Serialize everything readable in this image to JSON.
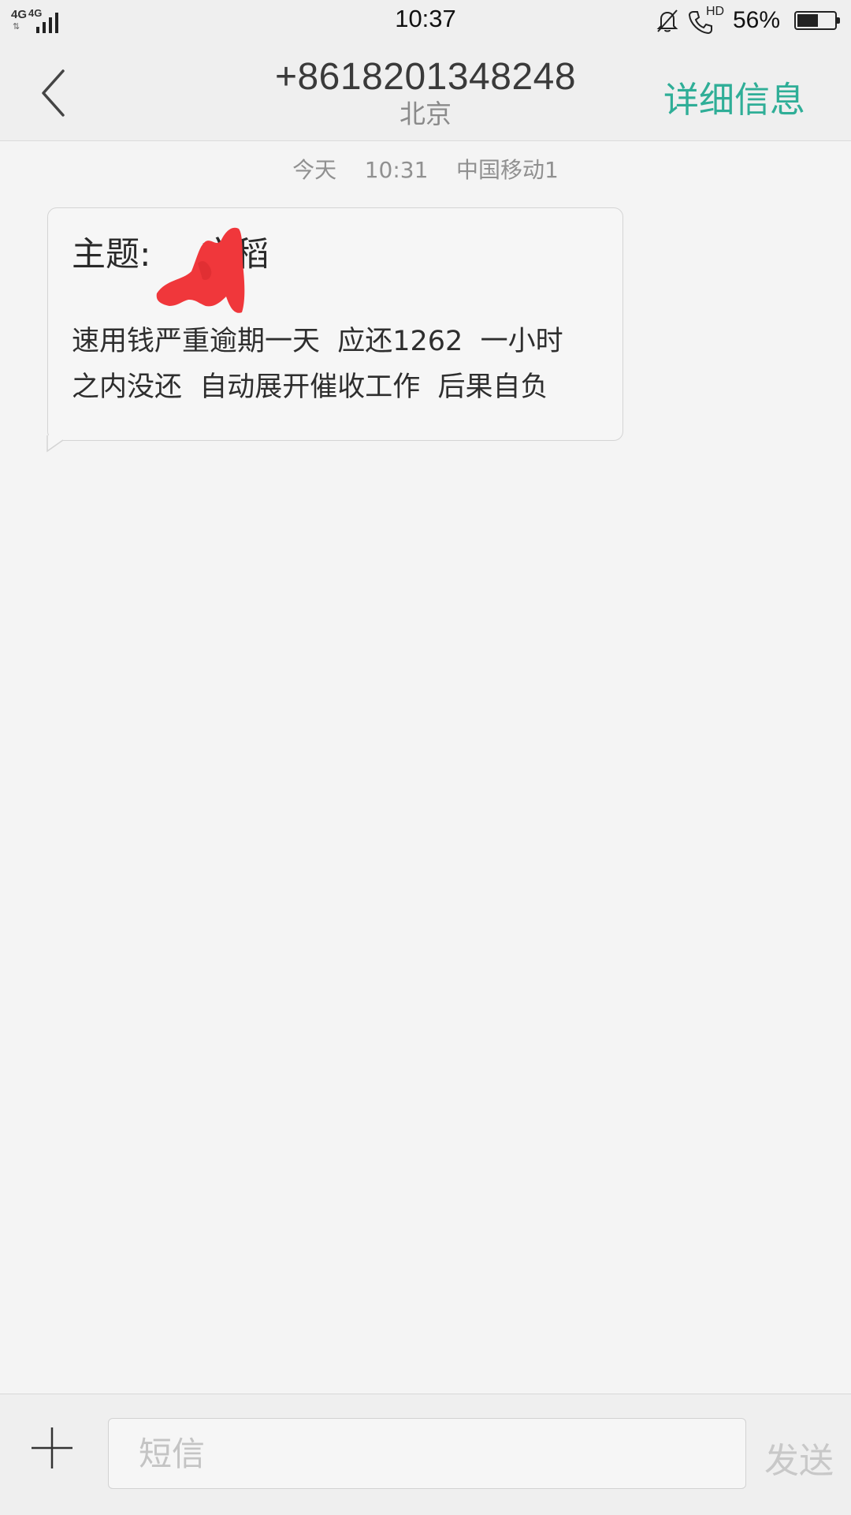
{
  "status_bar": {
    "network_label_1": "4G",
    "network_label_2": "4G",
    "time": "10:37",
    "hd_label": "HD",
    "battery_percent": "56%",
    "battery_level": 0.56,
    "icons": [
      "signal-icon",
      "mute-bell-icon",
      "hd-call-icon",
      "battery-icon"
    ]
  },
  "header": {
    "back_icon": "chevron-left-icon",
    "phone_number": "+8618201348248",
    "location": "北京",
    "details_label": "详细信息",
    "accent_color": "#2fae97"
  },
  "conversation": {
    "meta": "今天    10:31    中国移动1",
    "messages": [
      {
        "subject_prefix": "主题:",
        "subject_visible_part": "文稻",
        "subject_redacted": true,
        "body": "速用钱严重逾期一天  应还1262  一小时\n之内没还  自动展开催收工作  后果自负"
      }
    ]
  },
  "composer": {
    "add_icon": "plus-icon",
    "placeholder": "短信",
    "value": "",
    "send_label": "发送"
  }
}
